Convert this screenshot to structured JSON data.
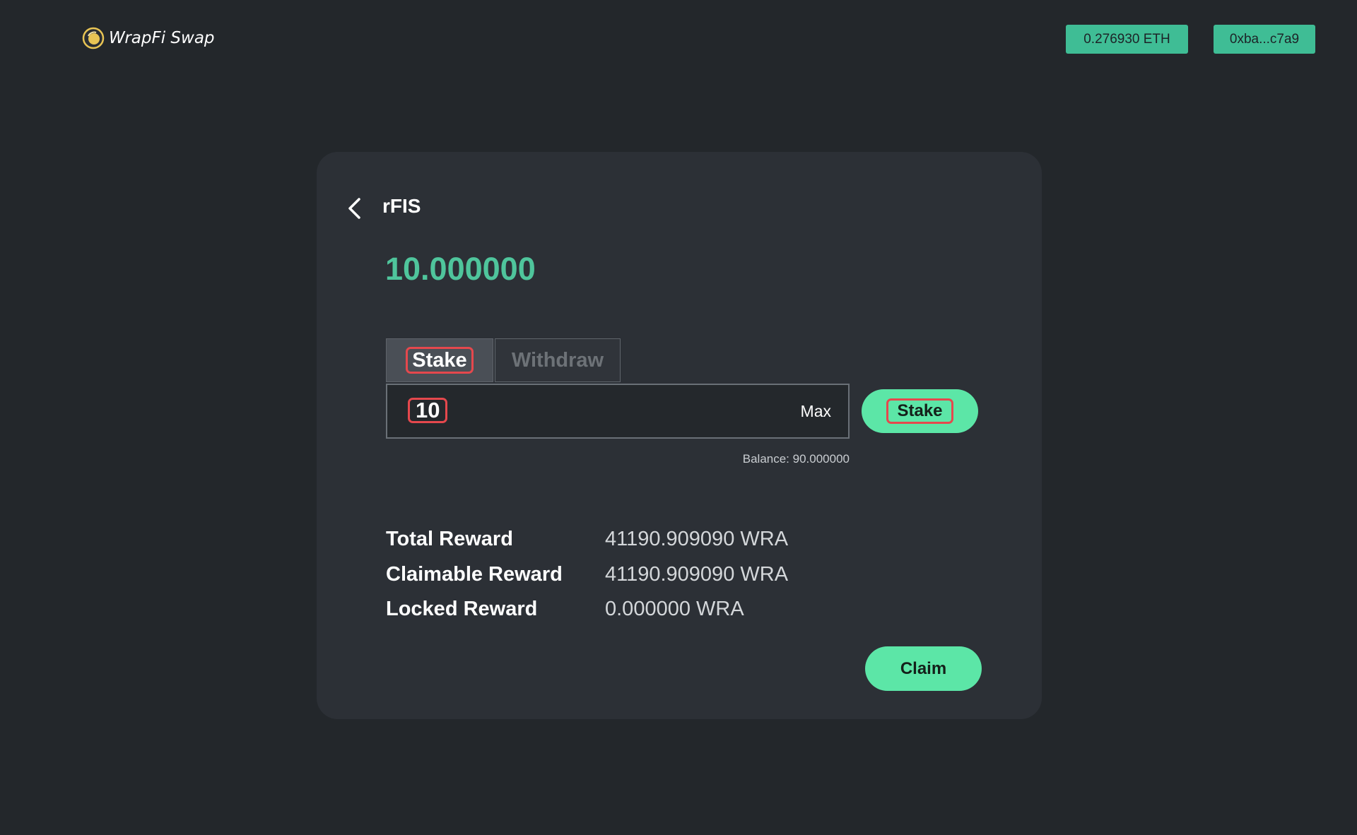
{
  "header": {
    "brand": "WrapFi Swap",
    "logo_icon": "coin-logo-icon",
    "eth_balance": "0.276930 ETH",
    "wallet_address": "0xba...c7a9",
    "accent_color": "#3fbd95"
  },
  "card": {
    "back_icon": "chevron-left-icon",
    "token_name": "rFIS",
    "staked_amount": "10.000000",
    "tabs": [
      {
        "label": "Stake",
        "active": true
      },
      {
        "label": "Withdraw",
        "active": false
      }
    ],
    "amount_input": {
      "value": "10",
      "max_label": "Max"
    },
    "submit_label": "Stake",
    "balance_text": "Balance: 90.000000",
    "rewards": [
      {
        "label": "Total Reward",
        "value": "41190.909090 WRA"
      },
      {
        "label": "Claimable Reward",
        "value": "41190.909090 WRA"
      },
      {
        "label": "Locked Reward",
        "value": "0.000000 WRA"
      }
    ],
    "claim_label": "Claim",
    "button_color": "#5ce6a7",
    "highlight_color": "#e5484d"
  }
}
